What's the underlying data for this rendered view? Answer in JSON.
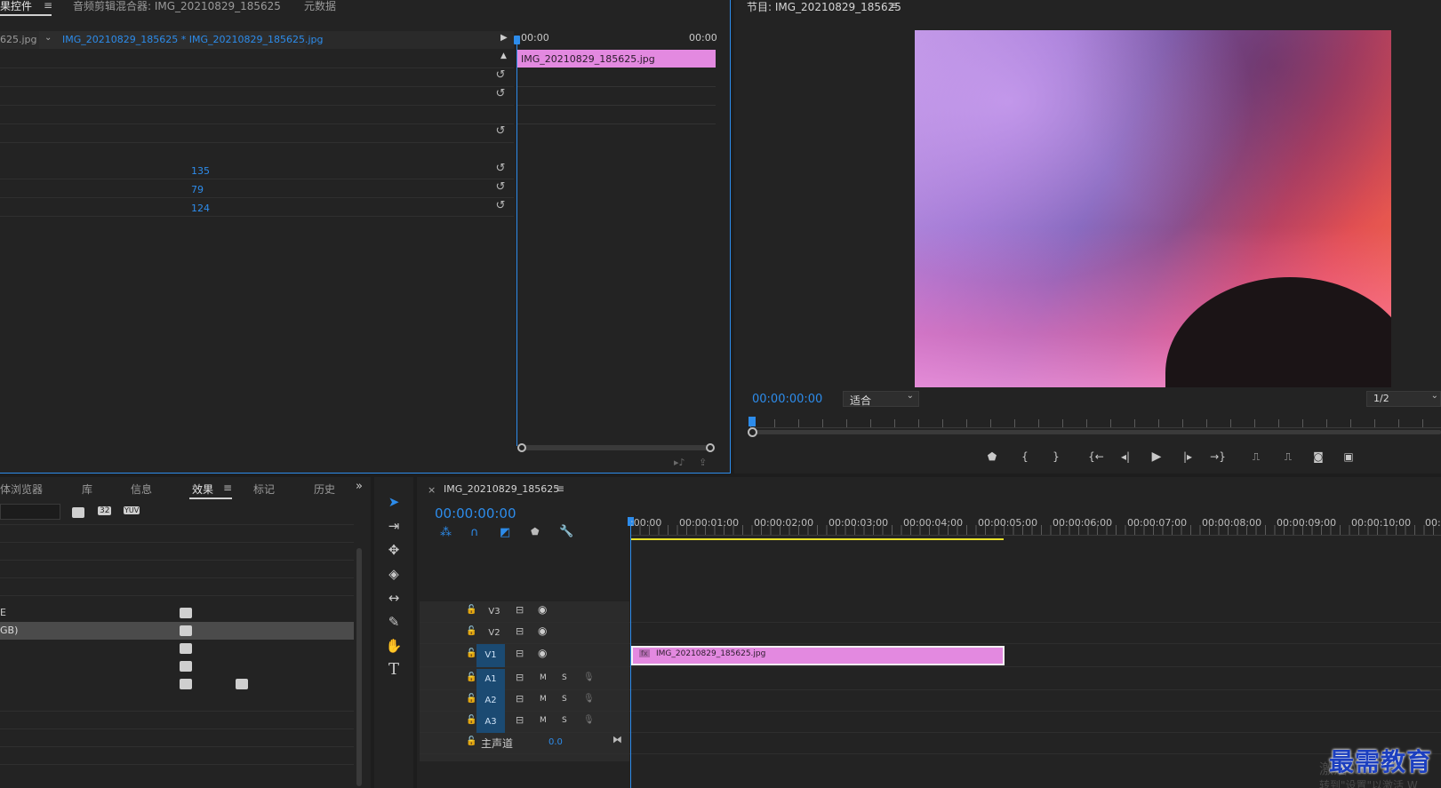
{
  "effect_controls": {
    "tabs": [
      {
        "label": "果控件",
        "active": true
      },
      {
        "label": "音频剪辑混合器: IMG_20210829_185625",
        "active": false
      },
      {
        "label": "元数据",
        "active": false
      }
    ],
    "menu_icon": "hamburger-icon",
    "source_label": "625.jpg",
    "clip_label": "IMG_20210829_185625 * IMG_20210829_185625.jpg",
    "timecode_start": "00:00",
    "timecode_end": "00:00",
    "clip_bar_label": "IMG_20210829_185625.jpg",
    "values": [
      "135",
      "79",
      "124"
    ]
  },
  "program_monitor": {
    "title": "节目: IMG_20210829_185625",
    "timecode": "00:00:00:00",
    "fit_select": "适合",
    "resolution_select": "1/2"
  },
  "project_panel": {
    "tabs": [
      {
        "label": "体浏览器",
        "active": false
      },
      {
        "label": "库",
        "active": false
      },
      {
        "label": "信息",
        "active": false
      },
      {
        "label": "效果",
        "active": true
      },
      {
        "label": "标记",
        "active": false
      },
      {
        "label": "历史",
        "active": false
      }
    ],
    "filter_icons": [
      "32",
      "YUV"
    ],
    "list_items": [
      "E",
      "GB)",
      "",
      "",
      ""
    ]
  },
  "timeline": {
    "sequence_name": "IMG_20210829_185625",
    "timecode": "00:00:00:00",
    "ruler_labels": [
      ":00:00",
      "00:00:01:00",
      "00:00:02:00",
      "00:00:03:00",
      "00:00:04:00",
      "00:00:05:00",
      "00:00:06:00",
      "00:00:07:00",
      "00:00:08:00",
      "00:00:09:00",
      "00:00:10:00",
      "00:"
    ],
    "video_tracks": [
      "V3",
      "V2",
      "V1"
    ],
    "audio_tracks": [
      "A1",
      "A2",
      "A3"
    ],
    "mute_label": "M",
    "solo_label": "S",
    "master_label": "主声道",
    "master_value": "0.0",
    "clip_label": "IMG_20210829_185625.jpg",
    "clip_fx": "fx",
    "close_label": "×"
  },
  "watermark": {
    "text": "最需教育",
    "faded_line1": "激活 Wi",
    "faded_line2": "转到\"设置\"以激活 W"
  },
  "colors": {
    "accent_blue": "#2d8ceb",
    "clip_pink": "#e389e0",
    "work_area_yellow": "#e8e02a",
    "track_target_blue": "#1b4a72"
  }
}
